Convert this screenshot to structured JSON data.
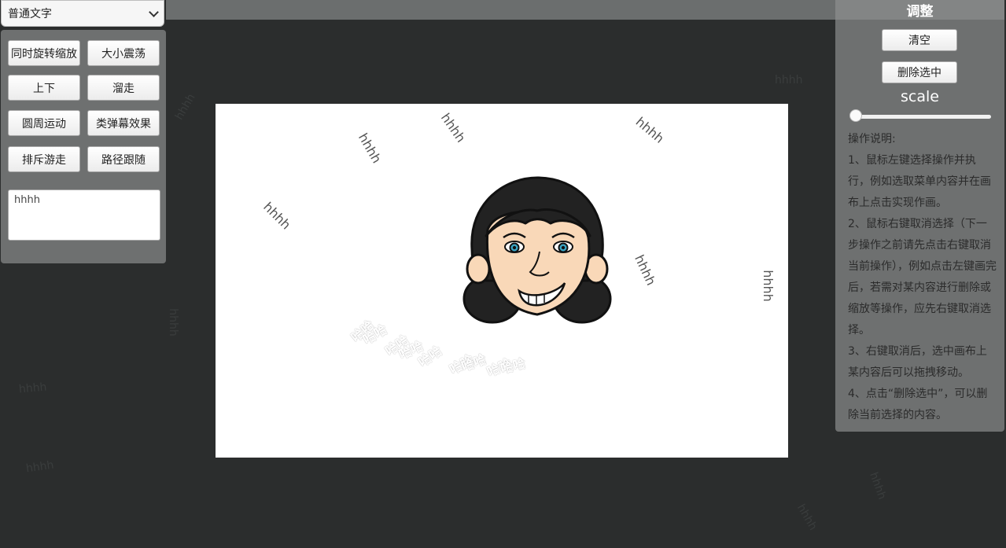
{
  "mode_select": {
    "value": "普通文字"
  },
  "left_panel": {
    "buttons": [
      "同时旋转缩放",
      "大小震荡",
      "上下",
      "溜走",
      "圆周运动",
      "类弹幕效果",
      "排斥游走",
      "路径跟随"
    ],
    "text_input": "hhhh"
  },
  "right_panel": {
    "title": "调整",
    "clear_button": "清空",
    "delete_button": "删除选中",
    "scale_label": "scale",
    "scale_value": 0,
    "instructions": [
      "操作说明:",
      "1、鼠标左键选择操作并执行，例如选取菜单内容并在画布上点击实现作画。",
      "2、鼠标右键取消选择（下一步操作之前请先点击右键取消当前操作），例如点击左键画完后，若需对某内容进行删除或缩放等操作，应先右键取消选择。",
      "3、右键取消后，选中画布上某内容后可以拖拽移动。",
      "4、点击“删除选中”，可以删除当前选择的内容。"
    ]
  },
  "canvas": {
    "hhhh_labels": [
      "hhhh",
      "hhhh",
      "hhhh",
      "hhhh",
      "hhhh",
      "hhhh"
    ],
    "haha_labels": [
      "哈哈",
      "哈哈",
      "哈哈",
      "哈哈",
      "哈哈",
      "哈哈",
      "哈哈",
      "哈哈",
      "哈哈"
    ]
  },
  "background_labels": [
    "hhhh",
    "hhhh",
    "hhhh",
    "hhhh",
    "hhhh",
    "hhhh",
    "hhhh"
  ],
  "colors": {
    "background": "#2b2d2d",
    "panel": "#6e7070",
    "canvas": "#ffffff"
  }
}
